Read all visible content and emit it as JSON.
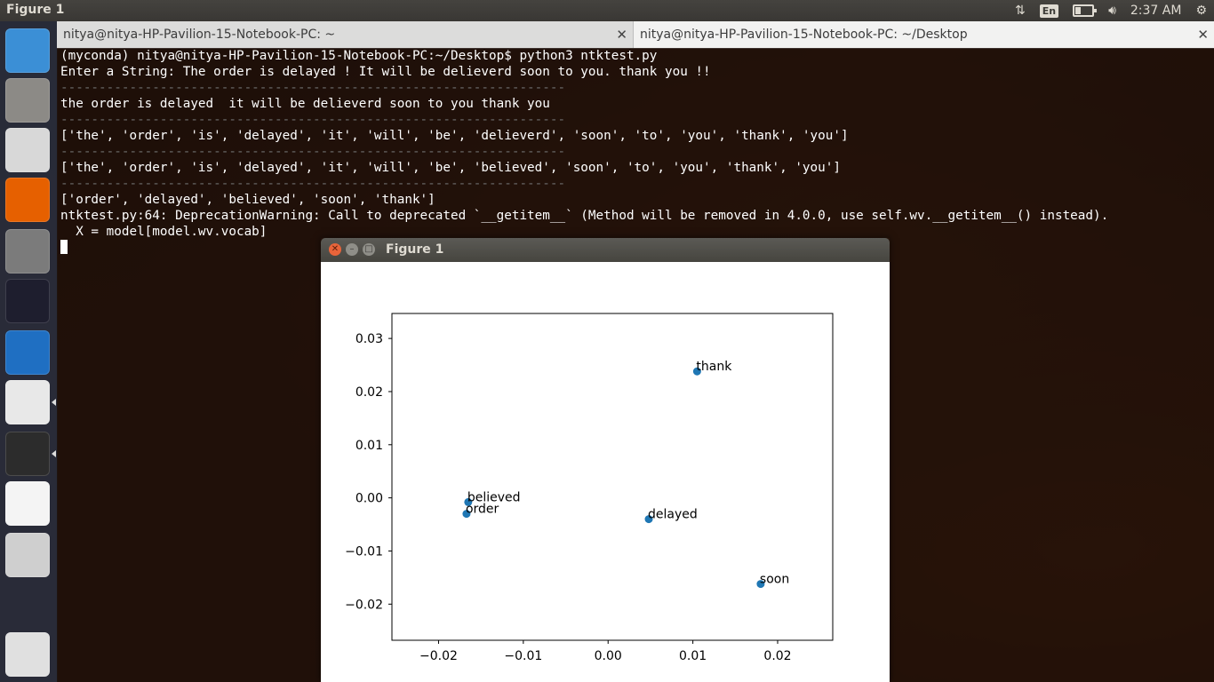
{
  "top_panel": {
    "title": "Figure 1",
    "keyboard_layout": "En",
    "clock": "2:37 AM"
  },
  "launcher": {
    "items": [
      {
        "name": "ubuntu-dash-icon",
        "color": "#3b8fd6"
      },
      {
        "name": "files-icon",
        "color": "#8c8a86"
      },
      {
        "name": "chrome-icon",
        "color": "#d8d8d8"
      },
      {
        "name": "firefox-icon",
        "color": "#e66000"
      },
      {
        "name": "system-settings-icon",
        "color": "#7b7b7b"
      },
      {
        "name": "pycharm-icon",
        "color": "#1e1e2e"
      },
      {
        "name": "vscode-icon",
        "color": "#1f6fc2"
      },
      {
        "name": "text-editor-icon",
        "color": "#e8e8e8"
      },
      {
        "name": "terminal-icon",
        "color": "#2c2c2c"
      },
      {
        "name": "mindmap-icon",
        "color": "#f4f4f4"
      },
      {
        "name": "disk-icon",
        "color": "#cfcfcf"
      },
      {
        "name": "trash-icon",
        "color": "#e0e0e0"
      }
    ]
  },
  "terminal": {
    "tabs": [
      {
        "label": "nitya@nitya-HP-Pavilion-15-Notebook-PC: ~"
      },
      {
        "label": "nitya@nitya-HP-Pavilion-15-Notebook-PC: ~/Desktop"
      }
    ],
    "lines": [
      {
        "text": "(myconda) nitya@nitya-HP-Pavilion-15-Notebook-PC:~/Desktop$ python3 ntktest.py",
        "sep": false
      },
      {
        "text": "Enter a String: The order is delayed ! It will be delieverd soon to you. thank you !!",
        "sep": false
      },
      {
        "text": "------------------------------------------------------------------",
        "sep": true
      },
      {
        "text": "the order is delayed  it will be delieverd soon to you thank you",
        "sep": false
      },
      {
        "text": "------------------------------------------------------------------",
        "sep": true
      },
      {
        "text": "['the', 'order', 'is', 'delayed', 'it', 'will', 'be', 'delieverd', 'soon', 'to', 'you', 'thank', 'you']",
        "sep": false
      },
      {
        "text": "------------------------------------------------------------------",
        "sep": true
      },
      {
        "text": "['the', 'order', 'is', 'delayed', 'it', 'will', 'be', 'believed', 'soon', 'to', 'you', 'thank', 'you']",
        "sep": false
      },
      {
        "text": "------------------------------------------------------------------",
        "sep": true
      },
      {
        "text": "['order', 'delayed', 'believed', 'soon', 'thank']",
        "sep": false
      },
      {
        "text": "ntktest.py:64: DeprecationWarning: Call to deprecated `__getitem__` (Method will be removed in 4.0.0, use self.wv.__getitem__() instead).",
        "sep": false
      },
      {
        "text": "  X = model[model.wv.vocab]",
        "sep": false
      }
    ]
  },
  "figure_window": {
    "title": "Figure 1"
  },
  "chart_data": {
    "type": "scatter",
    "points": [
      {
        "label": "thank",
        "x": 0.0105,
        "y": 0.0238
      },
      {
        "label": "believed",
        "x": -0.0165,
        "y": -0.0008
      },
      {
        "label": "order",
        "x": -0.0167,
        "y": -0.003
      },
      {
        "label": "delayed",
        "x": 0.0048,
        "y": -0.004
      },
      {
        "label": "soon",
        "x": 0.018,
        "y": -0.0162
      }
    ],
    "xlim": [
      -0.0255,
      0.0265
    ],
    "ylim": [
      -0.0268,
      0.0347
    ],
    "xticks": [
      -0.02,
      -0.01,
      0.0,
      0.01,
      0.02
    ],
    "xtick_labels": [
      "−0.02",
      "−0.01",
      "0.00",
      "0.01",
      "0.02"
    ],
    "yticks": [
      0.03,
      0.02,
      0.01,
      0.0,
      -0.01,
      -0.02
    ],
    "ytick_labels": [
      "0.03",
      "0.02",
      "0.01",
      "0.00",
      "−0.01",
      "−0.02"
    ],
    "marker_color": "#1f77b4",
    "grid": false
  }
}
